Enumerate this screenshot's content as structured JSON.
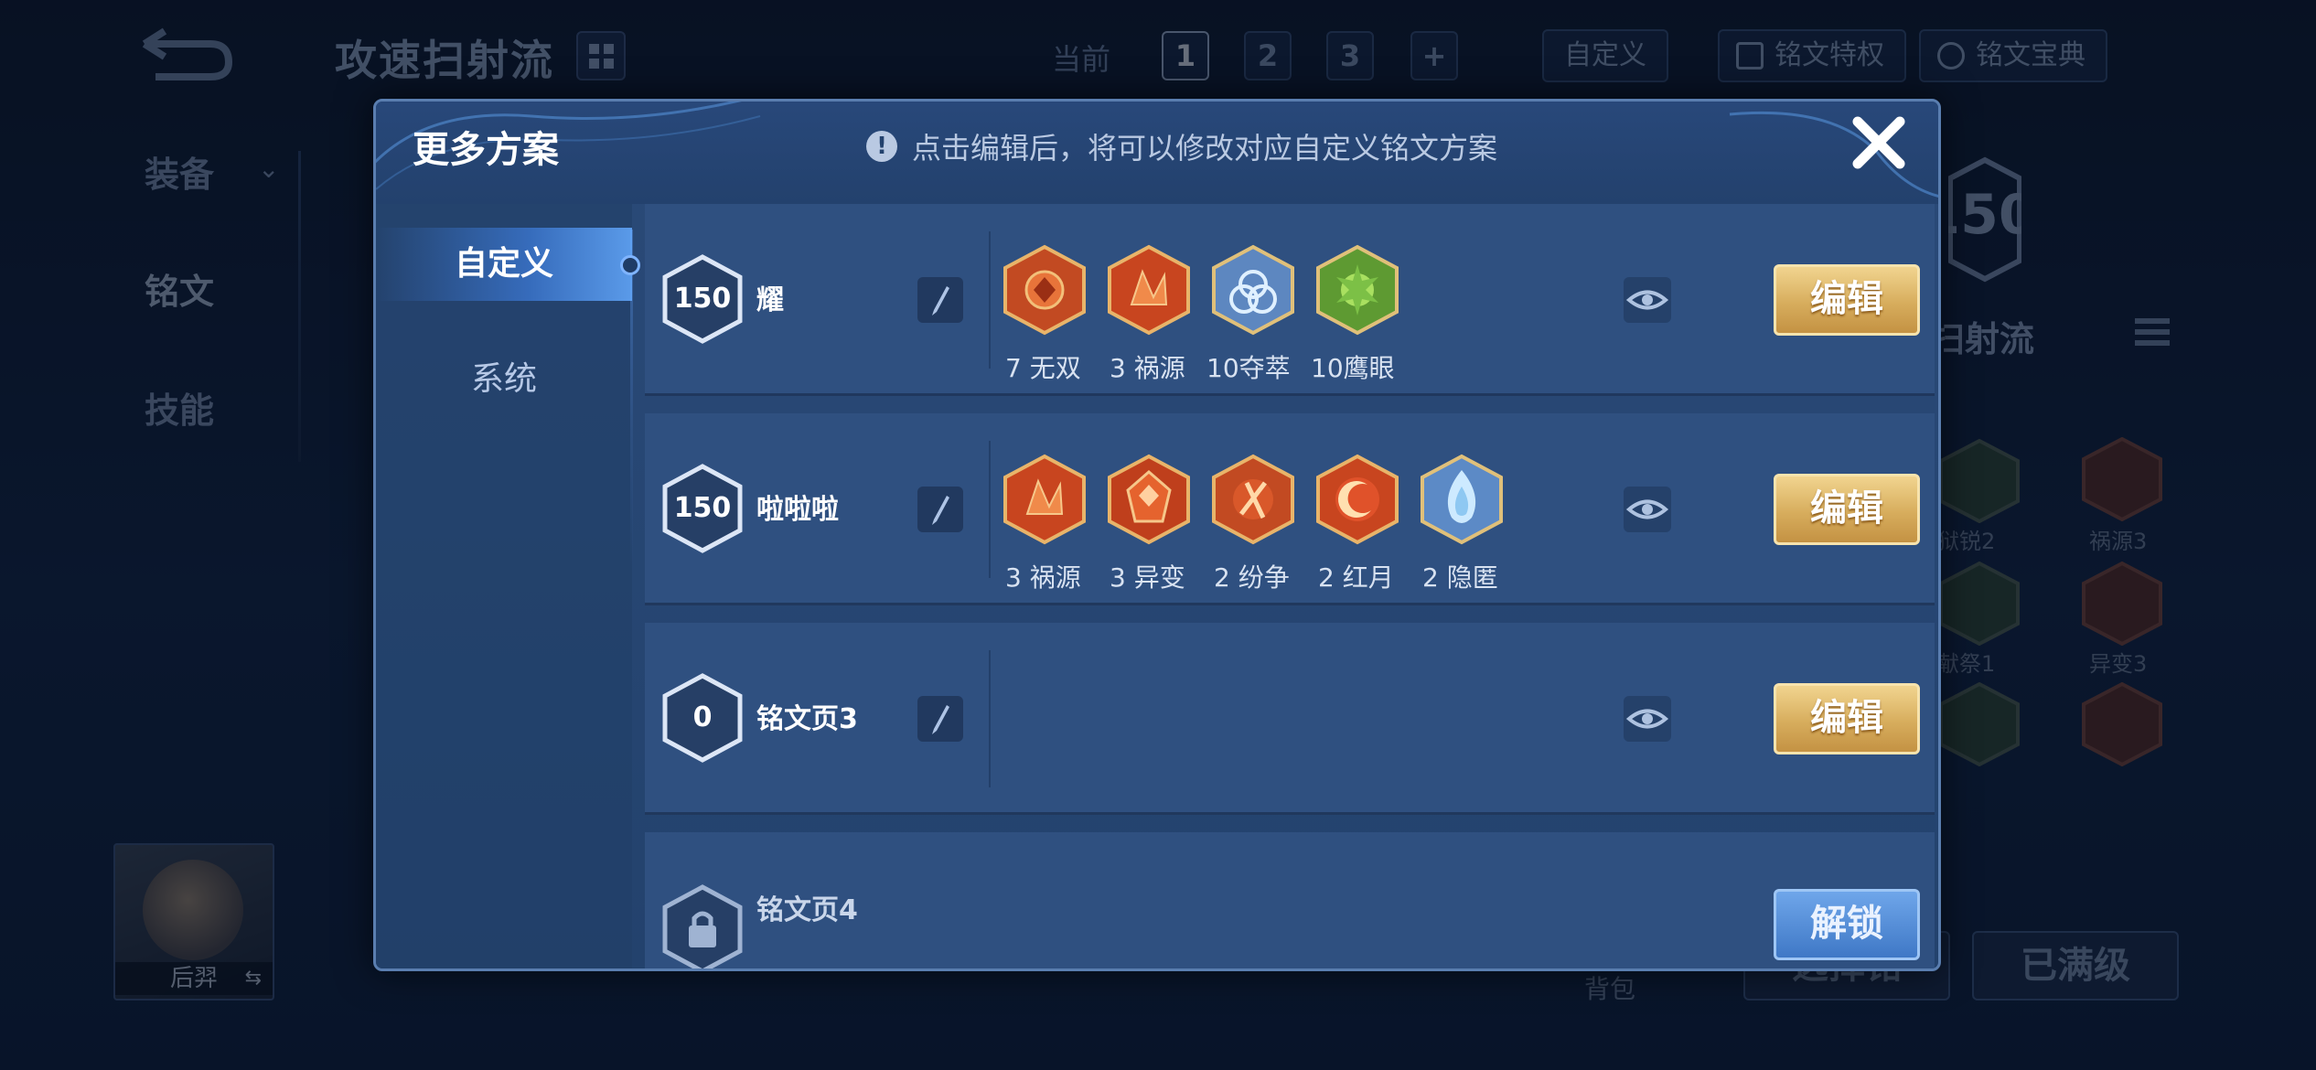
{
  "background": {
    "title": "攻速扫射流",
    "current_label": "当前",
    "pages": [
      "1",
      "2",
      "3"
    ],
    "add": "+",
    "custom": "自定义",
    "privilege": "铭文特权",
    "treasury": "铭文宝典",
    "nav": [
      "装备",
      "铭文",
      "技能"
    ],
    "hero_name": "后羿",
    "hero_swap_glyph": "⇆",
    "right_level": "150",
    "right_title": "扫射流",
    "right_runes": [
      "狱锐2",
      "祸源3",
      "献祭1",
      "异变3"
    ],
    "bag": "背包",
    "select_btn": "选择铭",
    "maxed_btn": "已满级"
  },
  "modal": {
    "title": "更多方案",
    "hint_icon": "!",
    "hint": "点击编辑后，将可以修改对应自定义铭文方案",
    "tabs": [
      "自定义",
      "系统"
    ],
    "edit_label": "编辑",
    "unlock_label": "解锁",
    "rows": [
      {
        "level": "150",
        "name": "耀",
        "runes": [
          {
            "label": "7 无双",
            "icon": "rune-red-wushuang-icon"
          },
          {
            "label": "3 祸源",
            "icon": "rune-red-huoyuan-icon"
          },
          {
            "label": "10夺萃",
            "icon": "rune-blue-duocui-icon"
          },
          {
            "label": "10鹰眼",
            "icon": "rune-green-yingyan-icon"
          }
        ]
      },
      {
        "level": "150",
        "name": "啦啦啦",
        "runes": [
          {
            "label": "3 祸源",
            "icon": "rune-red-huoyuan-icon"
          },
          {
            "label": "3 异变",
            "icon": "rune-red-yibian-icon"
          },
          {
            "label": "2 纷争",
            "icon": "rune-red-fenzheng-icon"
          },
          {
            "label": "2 红月",
            "icon": "rune-red-hongyue-icon"
          },
          {
            "label": "2 隐匿",
            "icon": "rune-blue-yinni-icon"
          }
        ]
      },
      {
        "level": "0",
        "name": "铭文页3",
        "runes": []
      },
      {
        "level": "",
        "name": "铭文页4",
        "locked": true,
        "runes": []
      }
    ]
  },
  "colors": {
    "accent_gold": "#d7ad5d",
    "accent_blue": "#3f78c6",
    "panel": "#2f5080"
  }
}
